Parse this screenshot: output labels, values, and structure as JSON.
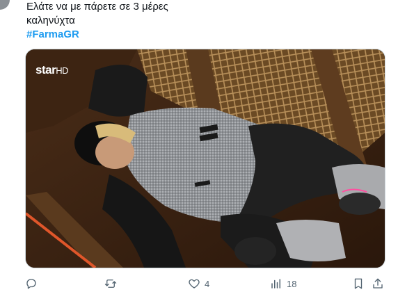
{
  "tweet": {
    "text_line_1": "Ελάτε να με πάρετε σε 3 μέρες",
    "text_line_2": "καληνύχτα",
    "hashtag": "#FarmaGR"
  },
  "media": {
    "channel_logo_star": "star",
    "channel_logo_hd": "HD"
  },
  "actions": {
    "reply_icon": "reply-icon",
    "retweet_icon": "retweet-icon",
    "like_count": "4",
    "views_count": "18",
    "bookmark_icon": "bookmark-icon",
    "share_icon": "share-icon"
  },
  "colors": {
    "hashtag": "#1d9bf0",
    "action_gray": "#536471"
  }
}
